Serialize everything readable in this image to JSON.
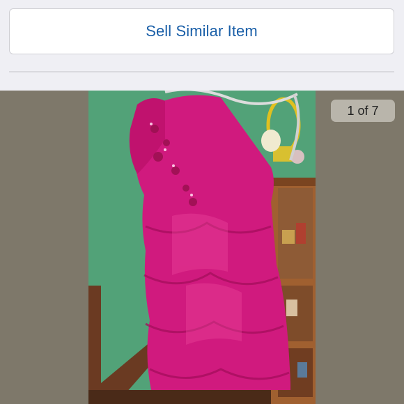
{
  "actions": {
    "sell_similar_label": "Sell Similar Item"
  },
  "gallery": {
    "counter_text": "1 of 7",
    "current_index": 1,
    "total_count": 7,
    "photo_icon": "listing-photo"
  },
  "colors": {
    "link_blue": "#1a5fa8",
    "dress_magenta": "#d01a7e",
    "gallery_backdrop": "#7e786a"
  }
}
